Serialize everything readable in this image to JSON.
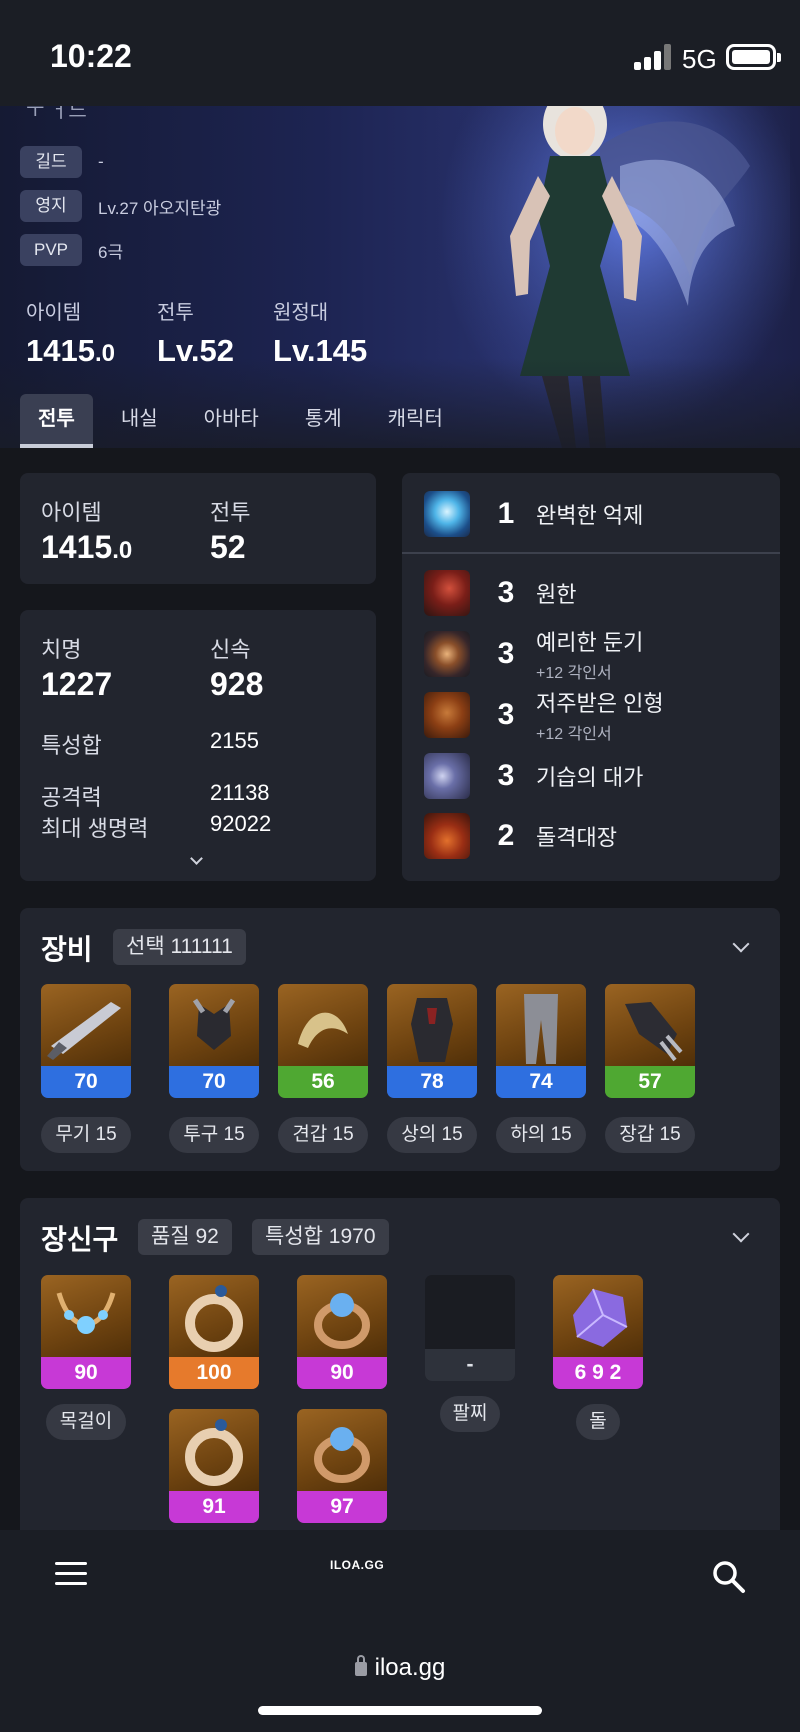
{
  "status_bar": {
    "time": "10:22",
    "network": "5G"
  },
  "hero": {
    "top_partial_text": "ㅜ ㅓ느",
    "info": [
      {
        "tag": "길드",
        "value": "-"
      },
      {
        "tag": "영지",
        "value": "Lv.27 아오지탄광"
      },
      {
        "tag": "PVP",
        "value": "6극"
      }
    ],
    "stats": [
      {
        "label": "아이템",
        "value": "1415",
        "decimal": ".0"
      },
      {
        "label": "전투",
        "value": "Lv.52"
      },
      {
        "label": "원정대",
        "value": "Lv.145"
      }
    ],
    "tabs": [
      "전투",
      "내실",
      "아바타",
      "통계",
      "캐릭터"
    ]
  },
  "summary": {
    "item_label": "아이템",
    "item_value": "1415",
    "item_decimal": ".0",
    "battle_label": "전투",
    "battle_value": "52"
  },
  "stats_card": {
    "crit_label": "치명",
    "crit_value": "1227",
    "swift_label": "신속",
    "swift_value": "928",
    "sum_label": "특성합",
    "sum_value": "2155",
    "atk_label": "공격력",
    "atk_value": "21138",
    "hp_label": "최대 생명력",
    "hp_value": "92022"
  },
  "engravings": [
    {
      "level": "1",
      "name": "완벽한 억제",
      "sub": "",
      "icon": "suppression-icon"
    },
    {
      "level": "3",
      "name": "원한",
      "sub": "",
      "icon": "grudge-icon"
    },
    {
      "level": "3",
      "name": "예리한 둔기",
      "sub": "+12 각인서",
      "icon": "keen-blunt-icon"
    },
    {
      "level": "3",
      "name": "저주받은 인형",
      "sub": "+12 각인서",
      "icon": "cursed-doll-icon"
    },
    {
      "level": "3",
      "name": "기습의 대가",
      "sub": "",
      "icon": "ambush-master-icon"
    },
    {
      "level": "2",
      "name": "돌격대장",
      "sub": "",
      "icon": "raid-captain-icon"
    }
  ],
  "equipment": {
    "title": "장비",
    "badge": "선택 111111",
    "items": [
      {
        "quality": "70",
        "label": "무기 15",
        "color": "blue",
        "icon": "weapon-icon"
      },
      {
        "quality": "70",
        "label": "투구 15",
        "color": "blue",
        "icon": "helmet-icon"
      },
      {
        "quality": "56",
        "label": "견갑 15",
        "color": "green",
        "icon": "shoulder-icon"
      },
      {
        "quality": "78",
        "label": "상의 15",
        "color": "blue",
        "icon": "chest-icon"
      },
      {
        "quality": "74",
        "label": "하의 15",
        "color": "blue",
        "icon": "pants-icon"
      },
      {
        "quality": "57",
        "label": "장갑 15",
        "color": "green",
        "icon": "gloves-icon"
      }
    ]
  },
  "accessories": {
    "title": "장신구",
    "badge_quality": "품질 92",
    "badge_sum": "특성합 1970",
    "necklace": {
      "quality": "90",
      "label": "목걸이"
    },
    "earring1": {
      "quality": "100"
    },
    "ring1": {
      "quality": "90"
    },
    "bracelet": {
      "quality": "-",
      "label": "팔찌"
    },
    "stone": {
      "quality": "6 9 2",
      "label": "돌"
    },
    "earring2": {
      "quality": "91"
    },
    "ring2": {
      "quality": "97"
    }
  },
  "bottom_nav": {
    "logo": "ILOA.GG"
  },
  "browser": {
    "url": "iloa.gg"
  },
  "colors": {
    "blue": "#2e6fe0",
    "green": "#4fa832",
    "purple": "#c739d6",
    "orange": "#e67a2c"
  }
}
